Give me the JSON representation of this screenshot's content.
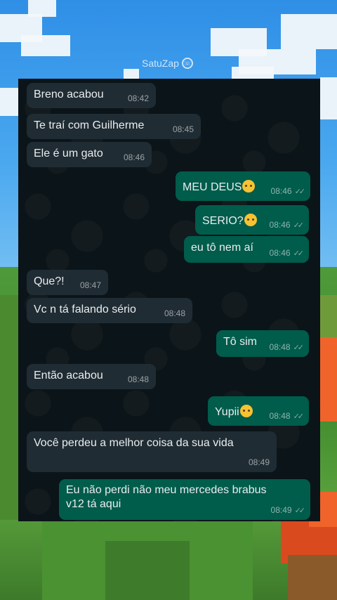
{
  "watermark": {
    "text": "SatuZap"
  },
  "colors": {
    "incoming": "#202c33",
    "outgoing": "#005c4b",
    "chat_bg": "#0b1418",
    "text": "#e9edef"
  },
  "messages": [
    {
      "dir": "in",
      "text": "Breno acabou",
      "time": "08:42"
    },
    {
      "dir": "in",
      "text": "Te traí com Guilherme",
      "time": "08:45"
    },
    {
      "dir": "in",
      "text": "Ele é um gato",
      "time": "08:46"
    },
    {
      "dir": "out",
      "text": "MEU DEUS",
      "emoji": "exploding-head-emoji",
      "time": "08:46"
    },
    {
      "dir": "out",
      "text": "SERIO?",
      "emoji": "pleading-face-emoji",
      "time": "08:46"
    },
    {
      "dir": "out",
      "text": "eu tô nem aí",
      "time": "08:46"
    },
    {
      "dir": "in",
      "text": "Que?!",
      "time": "08:47"
    },
    {
      "dir": "in",
      "text": "Vc n tá falando sério",
      "time": "08:48"
    },
    {
      "dir": "out",
      "text": "Tô sim",
      "time": "08:48"
    },
    {
      "dir": "in",
      "text": "Então acabou",
      "time": "08:48"
    },
    {
      "dir": "out",
      "text": "Yupii",
      "emoji": "partying-face-emoji",
      "time": "08:48"
    },
    {
      "dir": "in",
      "text": "Você perdeu a melhor coisa da sua vida",
      "time": "08:49"
    },
    {
      "dir": "out",
      "text_line1": "Eu não perdi não meu mercedes brabus",
      "text_line2": "v12 tá aqui",
      "time": "08:49"
    }
  ]
}
